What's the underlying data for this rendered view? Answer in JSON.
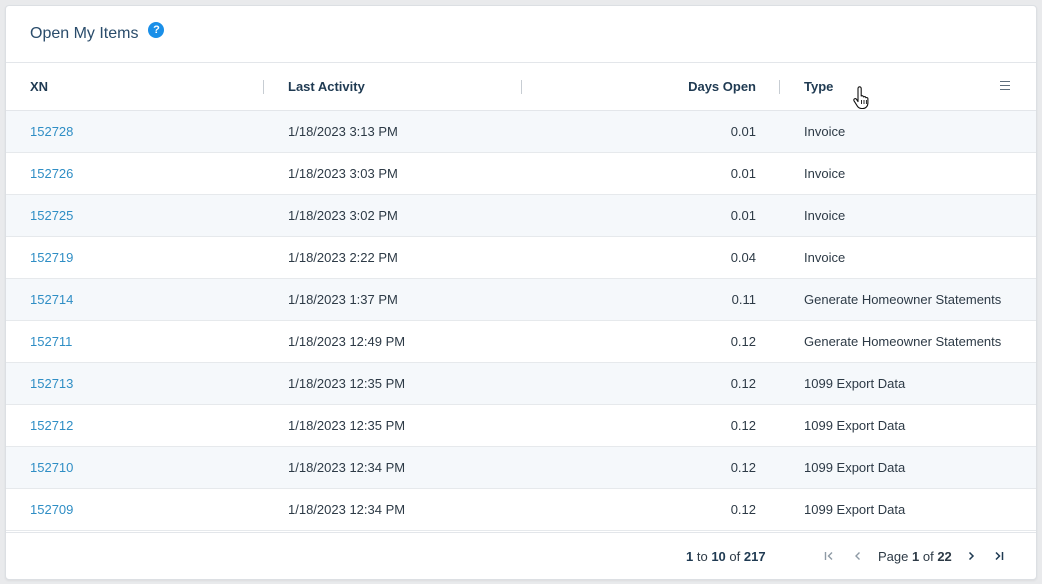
{
  "card": {
    "title": "Open My Items",
    "help_icon_glyph": "?"
  },
  "columns": {
    "xn": "XN",
    "last_activity": "Last Activity",
    "days_open": "Days Open",
    "type": "Type"
  },
  "rows": [
    {
      "xn": "152728",
      "last_activity": "1/18/2023 3:13 PM",
      "days_open": "0.01",
      "type": "Invoice"
    },
    {
      "xn": "152726",
      "last_activity": "1/18/2023 3:03 PM",
      "days_open": "0.01",
      "type": "Invoice"
    },
    {
      "xn": "152725",
      "last_activity": "1/18/2023 3:02 PM",
      "days_open": "0.01",
      "type": "Invoice"
    },
    {
      "xn": "152719",
      "last_activity": "1/18/2023 2:22 PM",
      "days_open": "0.04",
      "type": "Invoice"
    },
    {
      "xn": "152714",
      "last_activity": "1/18/2023 1:37 PM",
      "days_open": "0.11",
      "type": "Generate Homeowner Statements"
    },
    {
      "xn": "152711",
      "last_activity": "1/18/2023 12:49 PM",
      "days_open": "0.12",
      "type": "Generate Homeowner Statements"
    },
    {
      "xn": "152713",
      "last_activity": "1/18/2023 12:35 PM",
      "days_open": "0.12",
      "type": "1099 Export Data"
    },
    {
      "xn": "152712",
      "last_activity": "1/18/2023 12:35 PM",
      "days_open": "0.12",
      "type": "1099 Export Data"
    },
    {
      "xn": "152710",
      "last_activity": "1/18/2023 12:34 PM",
      "days_open": "0.12",
      "type": "1099 Export Data"
    },
    {
      "xn": "152709",
      "last_activity": "1/18/2023 12:34 PM",
      "days_open": "0.12",
      "type": "1099 Export Data"
    }
  ],
  "pager": {
    "range_start": "1",
    "range_to": "to",
    "range_end": "10",
    "range_of": "of",
    "total": "217",
    "page_word": "Page",
    "current_page": "1",
    "page_of": "of",
    "total_pages": "22"
  },
  "icons": {
    "help": "question-circle-icon",
    "column_menu": "hamburger-menu-icon",
    "cursor": "hand-pointer-icon",
    "first": "first-page-icon",
    "prev": "previous-page-icon",
    "next": "next-page-icon",
    "last": "last-page-icon"
  },
  "colors": {
    "accent": "#1a8fe8",
    "link": "#2f8ec5",
    "header_text": "#1f3a52",
    "row_alt": "#f5f8fb"
  }
}
